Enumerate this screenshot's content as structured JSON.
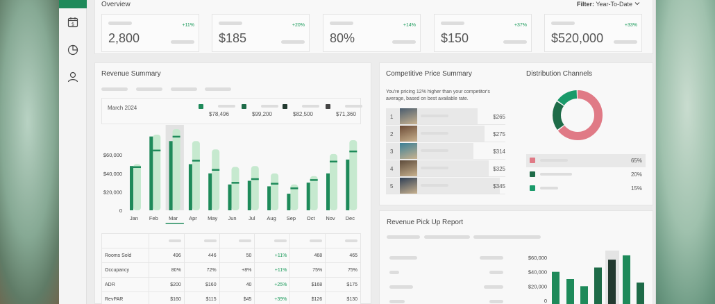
{
  "overview": {
    "title": "Overview",
    "filter_label": "Filter:",
    "filter_value": "Year-To-Date",
    "kpis": [
      {
        "value": "2,800",
        "change": "+11%"
      },
      {
        "value": "$185",
        "change": "+20%"
      },
      {
        "value": "80%",
        "change": "+14%"
      },
      {
        "value": "$150",
        "change": "+37%"
      },
      {
        "value": "$520,000",
        "change": "+33%"
      }
    ]
  },
  "revenue_summary": {
    "title": "Revenue Summary",
    "legend_month": "March 2024",
    "legend": [
      {
        "value": "$78,496",
        "color": "#1e8a5a"
      },
      {
        "value": "$99,200",
        "color": "#1e6b48"
      },
      {
        "value": "$82,500",
        "color": "#233a30"
      },
      {
        "value": "$71,360",
        "color": "#444444"
      }
    ],
    "selected_month": "Mar"
  },
  "chart_data": {
    "type": "bar",
    "categories": [
      "Jan",
      "Feb",
      "Mar",
      "Apr",
      "May",
      "Jun",
      "Jul",
      "Aug",
      "Sep",
      "Oct",
      "Nov",
      "Dec"
    ],
    "yticks": [
      "$60,000",
      "$40,000",
      "$20,000",
      "0"
    ],
    "ylim": [
      0,
      85000
    ],
    "series": [
      {
        "values": [
          48000,
          80000,
          75000,
          50000,
          40000,
          28000,
          32000,
          26000,
          18000,
          30000,
          40000,
          55000
        ]
      },
      {
        "values": [
          50000,
          82000,
          88000,
          75000,
          66000,
          47000,
          48000,
          40000,
          28000,
          37000,
          61000,
          76000
        ]
      }
    ],
    "marker_values": [
      47000,
      65000,
      80000,
      54000,
      44000,
      30000,
      34000,
      29000,
      24000,
      33000,
      53000,
      64000
    ],
    "colors": {
      "primary": "#1e8a5a",
      "light": "#c6e9cf",
      "marker": "#1e8a5a"
    }
  },
  "revenue_table": {
    "rows": [
      {
        "label": "Rooms Sold",
        "cells": [
          "496",
          "446",
          "50",
          "+11%",
          "468",
          "465"
        ]
      },
      {
        "label": "Occupancy",
        "cells": [
          "80%",
          "72%",
          "+8%",
          "+11%",
          "75%",
          "75%"
        ]
      },
      {
        "label": "ADR",
        "cells": [
          "$200",
          "$160",
          "40",
          "+25%",
          "$168",
          "$175"
        ]
      },
      {
        "label": "RevPAR",
        "cells": [
          "$160",
          "$115",
          "$45",
          "+39%",
          "$126",
          "$130"
        ]
      }
    ]
  },
  "competitive": {
    "title": "Competitive Price Summary",
    "note_line1": "You're pricing 12% higher than your competitor's",
    "note_line2": "average, based on best available rate.",
    "rows": [
      {
        "rank": "1",
        "price": "$265"
      },
      {
        "rank": "2",
        "price": "$275"
      },
      {
        "rank": "3",
        "price": "$314"
      },
      {
        "rank": "4",
        "price": "$325"
      },
      {
        "rank": "5",
        "price": "$345"
      }
    ]
  },
  "distribution": {
    "title": "Distribution Channels",
    "slices": [
      {
        "pct": "65%",
        "color": "#e07a86",
        "value": 65
      },
      {
        "pct": "20%",
        "color": "#1e6b48",
        "value": 20
      },
      {
        "pct": "15%",
        "color": "#1a9a6a",
        "value": 15
      }
    ]
  },
  "pickup": {
    "title": "Revenue Pick Up Report",
    "yticks": [
      "$60,000",
      "$40,000",
      "$20,000",
      "0"
    ]
  },
  "icons": [
    "calendar-dollar-icon",
    "pie-chart-icon",
    "user-icon",
    "chevron-down-icon"
  ]
}
